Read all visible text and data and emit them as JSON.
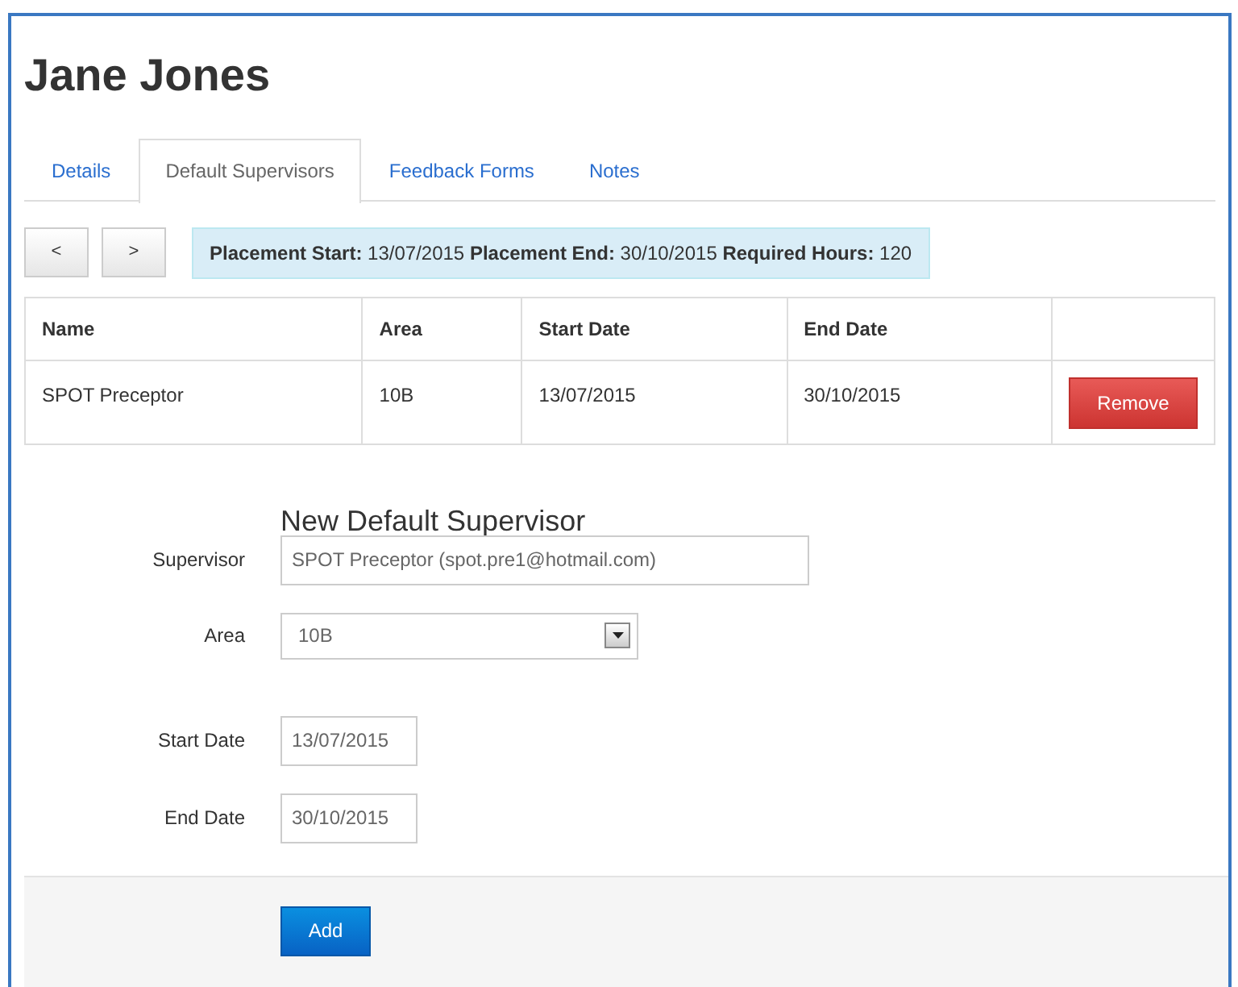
{
  "title": "Jane Jones",
  "tabs": [
    {
      "label": "Details",
      "selected": false
    },
    {
      "label": "Default Supervisors",
      "selected": true
    },
    {
      "label": "Feedback Forms",
      "selected": false
    },
    {
      "label": "Notes",
      "selected": false
    }
  ],
  "pager": {
    "prev": "<",
    "next": ">"
  },
  "placement_info": "**Placement Start:** 13/07/2015 **Placement End:** 30/10/2015 **Required Hours:** 120",
  "table": {
    "columns": [
      "Name",
      "Area",
      "Start Date",
      "End Date"
    ],
    "rows": [
      {
        "cells": [
          "SPOT Preceptor",
          "10B",
          "13/07/2015",
          "30/10/2015"
        ],
        "action": "Remove"
      }
    ]
  },
  "form": {
    "title": "New Default Supervisor",
    "fields": [
      {
        "kind": "text",
        "label": "Supervisor",
        "value": "SPOT Preceptor (spot.pre1@hotmail.com)"
      },
      {
        "kind": "select",
        "label": "Area",
        "value": "10B"
      },
      {
        "kind": "date",
        "label": "Start Date",
        "value": "13/07/2015"
      },
      {
        "kind": "date",
        "label": "End Date",
        "value": "30/10/2015"
      }
    ],
    "submit": "Add"
  }
}
